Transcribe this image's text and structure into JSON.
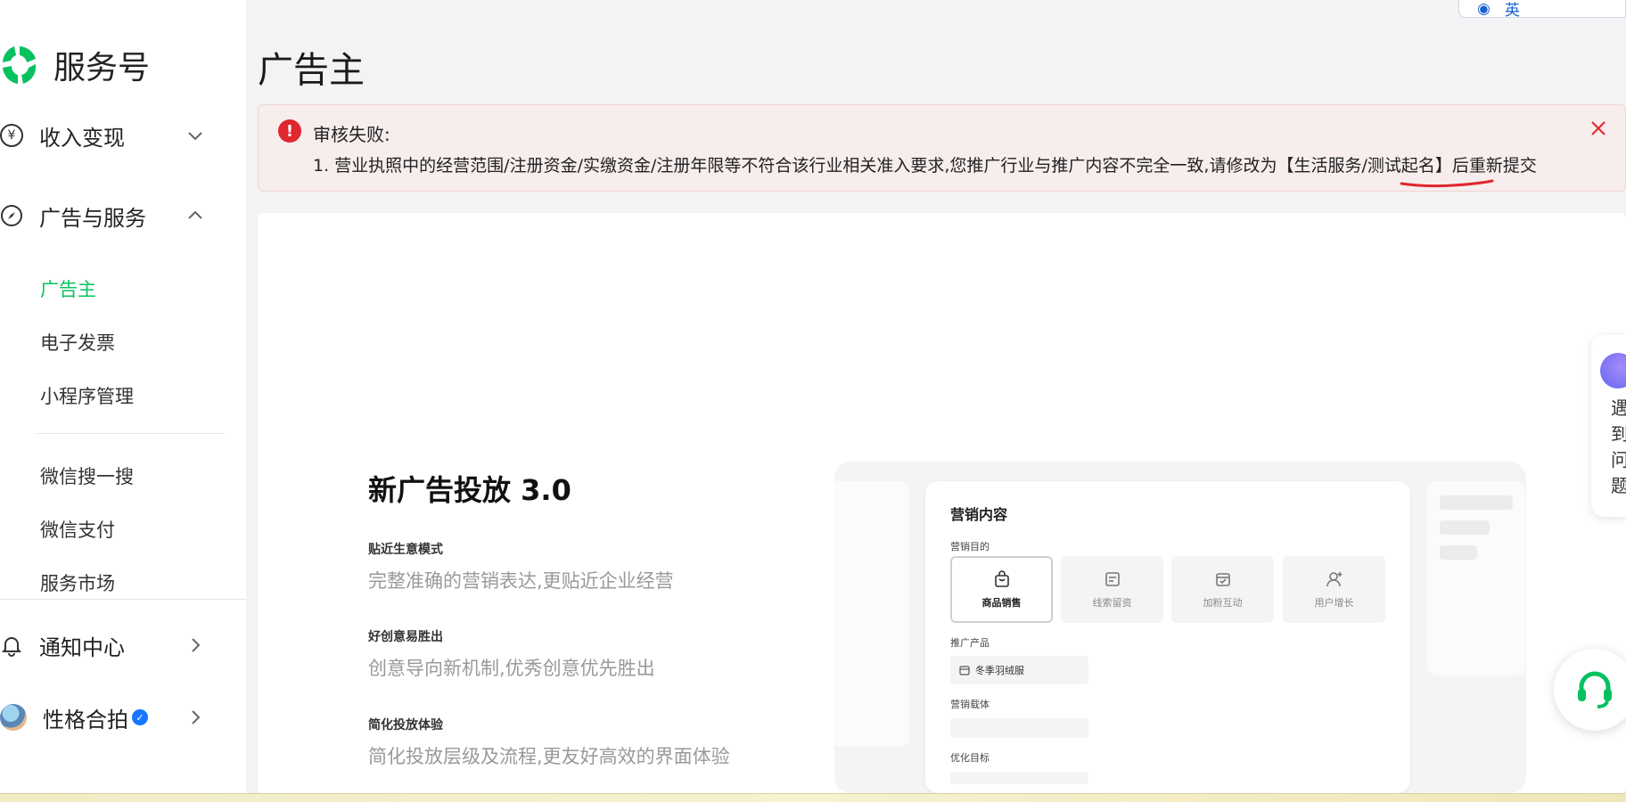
{
  "app": {
    "logo_text": "服务号"
  },
  "sidebar": {
    "groups": [
      {
        "label": "收入变现",
        "icon": "yen-circle-icon",
        "icon_glyph": "¥",
        "expanded": false
      },
      {
        "label": "广告与服务",
        "icon": "compass-icon",
        "icon_glyph": "⊘",
        "expanded": true
      }
    ],
    "items": [
      {
        "label": "广告主",
        "active": true
      },
      {
        "label": "电子发票"
      },
      {
        "label": "小程序管理"
      },
      {
        "label": "微信搜一搜"
      },
      {
        "label": "微信支付"
      },
      {
        "label": "服务市场"
      }
    ],
    "notify": {
      "label": "通知中心",
      "icon": "bell-icon"
    },
    "account": {
      "name": "性格合拍",
      "verified": true
    }
  },
  "page": {
    "title": "广告主"
  },
  "alert": {
    "title": "审核失败:",
    "message": "1. 营业执照中的经营范围/注册资金/实缴资金/注册年限等不符合该行业相关准入要求,您推广行业与推广内容不完全一致,请修改为【生活服务/测试起名】后重新提交",
    "color": "#e0262e"
  },
  "promo": {
    "title": "新广告投放 3.0",
    "features": [
      {
        "title": "贴近生意模式",
        "desc": "完整准确的营销表达,更贴近企业经营"
      },
      {
        "title": "好创意易胜出",
        "desc": "创意导向新机制,优秀创意优先胜出"
      },
      {
        "title": "简化投放体验",
        "desc": "简化投放层级及流程,更友好高效的界面体验"
      }
    ]
  },
  "preview": {
    "panel_title": "营销内容",
    "goal_label": "营销目的",
    "goals": [
      {
        "label": "商品销售",
        "icon": "shopping-bag-icon",
        "selected": true
      },
      {
        "label": "线索留资",
        "icon": "form-icon"
      },
      {
        "label": "加粉互动",
        "icon": "calendar-check-icon"
      },
      {
        "label": "用户增长",
        "icon": "user-plus-icon"
      }
    ],
    "product_label": "推广产品",
    "product_value": "冬季羽绒服",
    "carrier_label": "营销载体",
    "optimize_label": "优化目标"
  },
  "floating": {
    "tip_text": "遇到问题"
  },
  "ime": {
    "lang": "英"
  },
  "colors": {
    "accent": "#07c160",
    "brand_logo": "#07c160"
  }
}
